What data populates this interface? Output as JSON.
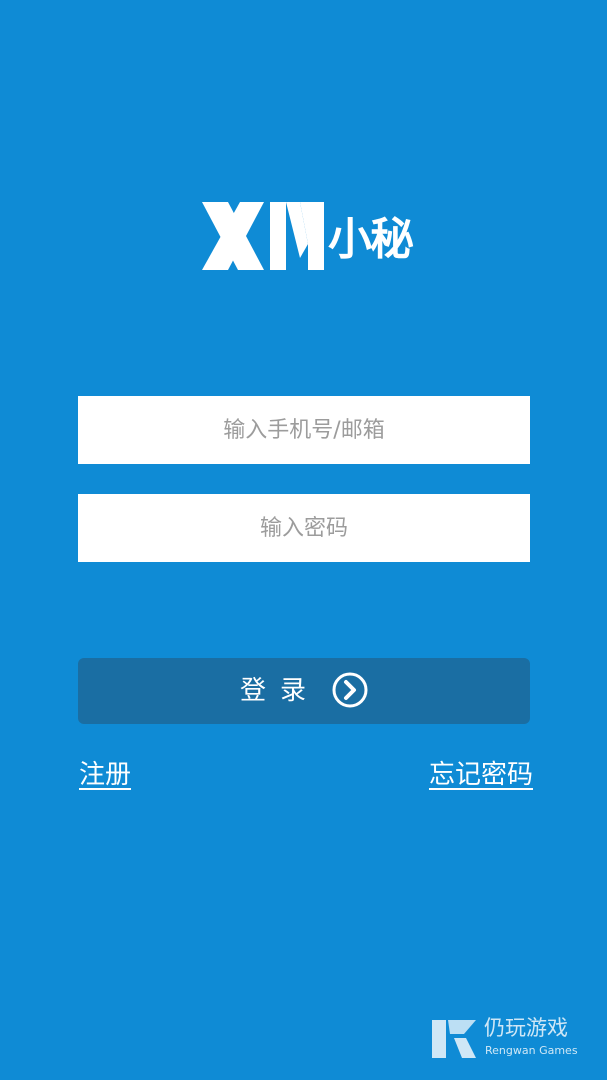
{
  "logo": {
    "latin_text": "XM",
    "chinese_text": "小秘"
  },
  "form": {
    "phone_placeholder": "输入手机号/邮箱",
    "password_placeholder": "输入密码",
    "login_label": "登录"
  },
  "links": {
    "register": "注册",
    "forgot_password": "忘记密码"
  },
  "watermark": {
    "chinese": "仍玩游戏",
    "english": "Rengwan Games"
  },
  "colors": {
    "background": "#0f8bd5",
    "login_button": "#1a6ea3",
    "field_background": "#ffffff",
    "placeholder": "#9c9c9c",
    "text_light": "#ffffff"
  },
  "icons": {
    "login_arrow": "chevron-right-circle-icon",
    "watermark_logo": "rengwan-logo-icon"
  }
}
